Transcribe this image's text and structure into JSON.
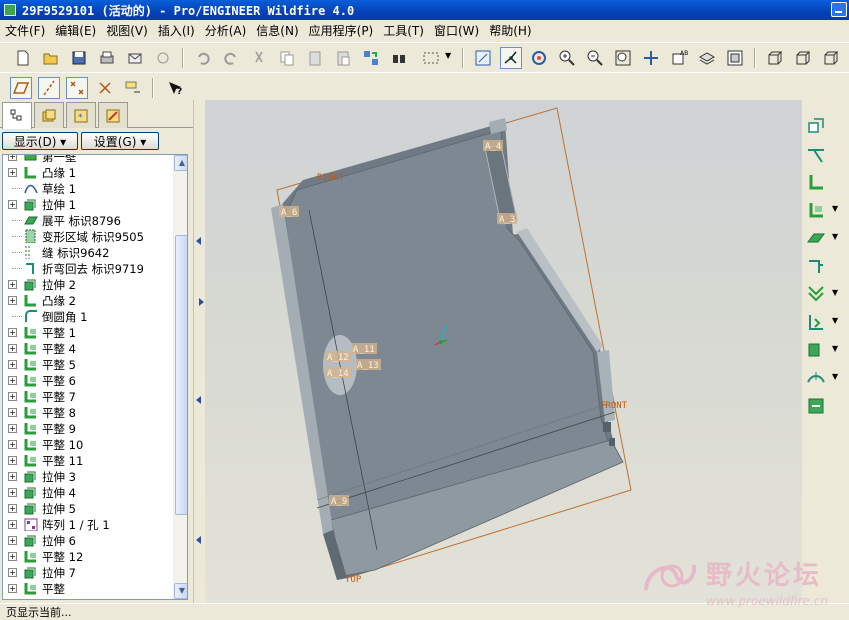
{
  "window": {
    "title": "29F9529101 (活动的) - Pro/ENGINEER Wildfire 4.0"
  },
  "menu": [
    "文件(F)",
    "编辑(E)",
    "视图(V)",
    "插入(I)",
    "分析(A)",
    "信息(N)",
    "应用程序(P)",
    "工具(T)",
    "窗口(W)",
    "帮助(H)"
  ],
  "toolbar1": {
    "icons": [
      "new-icon",
      "open-icon",
      "save-icon",
      "print-icon",
      "email-icon",
      "email-link-icon",
      "undo-icon",
      "redo-icon",
      "cut-icon",
      "copy-icon",
      "paste-icon",
      "paste-special-icon",
      "regenerate-icon",
      "find-icon",
      "select-box-icon",
      "redraw-icon",
      "spin-center-icon",
      "orient-mode-icon",
      "zoom-in-icon",
      "zoom-out-icon",
      "refit-icon",
      "reorient-icon",
      "saved-views-icon",
      "layers-icon",
      "view-manager-icon",
      "wireframe-icon",
      "hidden-line-icon",
      "no-hidden-icon"
    ]
  },
  "toolbar2": {
    "icons": [
      "datum-planes-icon",
      "datum-axes-icon",
      "datum-points-icon",
      "datum-csys-icon",
      "annotation-display-icon",
      "context-help-icon"
    ]
  },
  "navigator": {
    "tabs": [
      "model-tree-tab",
      "layer-tree-tab",
      "favorites-tab",
      "connections-tab"
    ],
    "show_button": "显示(D) ▾",
    "settings_button": "设置(G) ▾",
    "tree_items": [
      {
        "label": "第一壁",
        "icon": "sheetmetal-wall-icon",
        "expandable": true
      },
      {
        "label": "凸缘 1",
        "icon": "flange-icon",
        "expandable": true
      },
      {
        "label": "草绘 1",
        "icon": "sketch-icon",
        "expandable": false
      },
      {
        "label": "拉伸 1",
        "icon": "extrude-icon",
        "expandable": true
      },
      {
        "label": "展平 标识8796",
        "icon": "unbend-icon",
        "expandable": false
      },
      {
        "label": "变形区域 标识9505",
        "icon": "deform-area-icon",
        "expandable": false
      },
      {
        "label": "缝 标识9642",
        "icon": "rip-icon",
        "expandable": false
      },
      {
        "label": "折弯回去 标识9719",
        "icon": "bend-back-icon",
        "expandable": false
      },
      {
        "label": "拉伸 2",
        "icon": "extrude-icon",
        "expandable": true
      },
      {
        "label": "凸缘 2",
        "icon": "flange-icon",
        "expandable": true
      },
      {
        "label": "倒圆角 1",
        "icon": "round-icon",
        "expandable": false
      },
      {
        "label": "平整 1",
        "icon": "flat-wall-icon",
        "expandable": true
      },
      {
        "label": "平整 4",
        "icon": "flat-wall-icon",
        "expandable": true
      },
      {
        "label": "平整 5",
        "icon": "flat-wall-icon",
        "expandable": true
      },
      {
        "label": "平整 6",
        "icon": "flat-wall-icon",
        "expandable": true
      },
      {
        "label": "平整 7",
        "icon": "flat-wall-icon",
        "expandable": true
      },
      {
        "label": "平整 8",
        "icon": "flat-wall-icon",
        "expandable": true
      },
      {
        "label": "平整 9",
        "icon": "flat-wall-icon",
        "expandable": true
      },
      {
        "label": "平整 10",
        "icon": "flat-wall-icon",
        "expandable": true
      },
      {
        "label": "平整 11",
        "icon": "flat-wall-icon",
        "expandable": true
      },
      {
        "label": "拉伸 3",
        "icon": "extrude-icon",
        "expandable": true
      },
      {
        "label": "拉伸 4",
        "icon": "extrude-icon",
        "expandable": true
      },
      {
        "label": "拉伸 5",
        "icon": "extrude-icon",
        "expandable": true
      },
      {
        "label": "阵列 1 / 孔 1",
        "icon": "pattern-icon",
        "expandable": true
      },
      {
        "label": "拉伸 6",
        "icon": "extrude-icon",
        "expandable": true
      },
      {
        "label": "平整 12",
        "icon": "flat-wall-icon",
        "expandable": true
      },
      {
        "label": "拉伸 7",
        "icon": "extrude-icon",
        "expandable": true
      },
      {
        "label": "平整",
        "icon": "flat-wall-icon",
        "expandable": true
      }
    ]
  },
  "graphics": {
    "datum_planes": [
      "RIGHT",
      "FRONT",
      "TOP"
    ],
    "axes": [
      "A_4",
      "A_3",
      "A_6",
      "A_11",
      "A_12",
      "A_13",
      "A_14",
      "A_9"
    ],
    "colors": {
      "part": "#7b8690",
      "part_edge": "#9aa3ab",
      "datum": "#c07030"
    }
  },
  "right_toolbar": {
    "icons": [
      "conversion-icon",
      "unattached-wall-icon",
      "flange-wall-icon",
      "flat-wall-icon",
      "unbend-icon",
      "bend-back-icon",
      "punch-icon",
      "rip-icon",
      "corner-relief-icon",
      "bend-icon",
      "form-icon",
      "flatten-icon"
    ]
  },
  "statusbar": {
    "text": "页显示当前..."
  },
  "watermark": {
    "title": "野火论坛",
    "url": "www.proewildfire.cn"
  }
}
